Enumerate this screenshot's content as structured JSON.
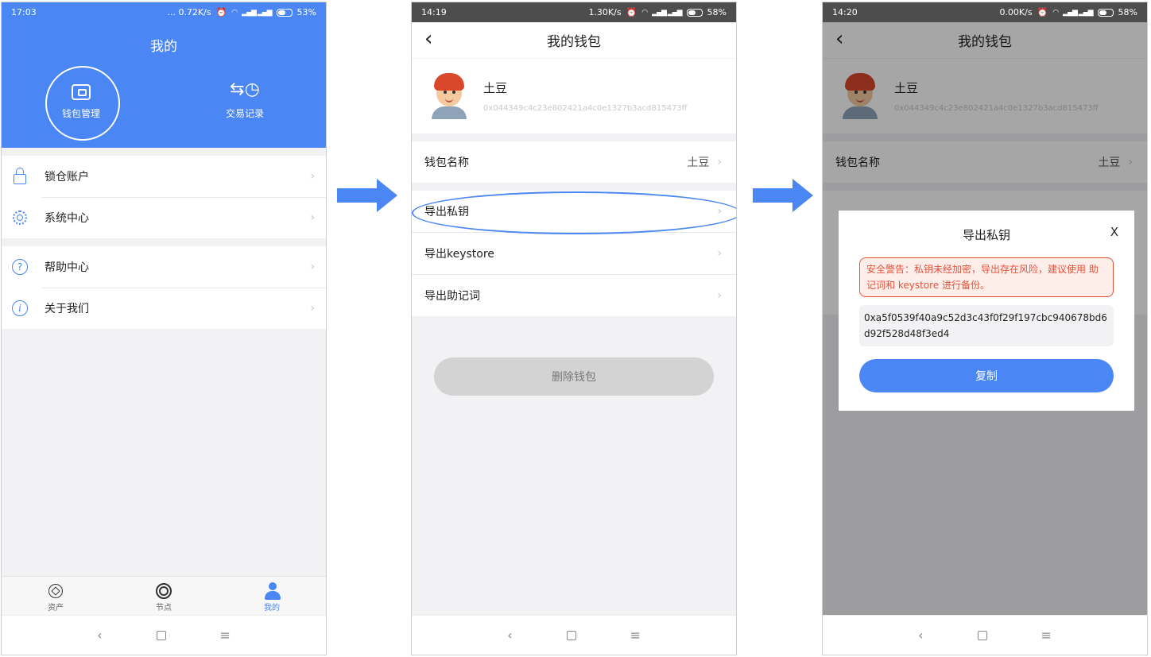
{
  "screen1": {
    "status": {
      "time": "17:03",
      "info": "... 0.72K/s",
      "battery": "53%"
    },
    "title": "我的",
    "hero_items": [
      {
        "label": "钱包管理"
      },
      {
        "label": "交易记录"
      }
    ],
    "menu_groups": [
      [
        {
          "label": "锁仓账户"
        },
        {
          "label": "系统中心"
        }
      ],
      [
        {
          "label": "帮助中心"
        },
        {
          "label": "关于我们"
        }
      ]
    ],
    "tabs": [
      {
        "label": "资产"
      },
      {
        "label": "节点"
      },
      {
        "label": "我的"
      }
    ]
  },
  "screen2": {
    "status": {
      "time": "14:19",
      "info": "1.30K/s",
      "battery": "58%"
    },
    "title": "我的钱包",
    "wallet_name": "土豆",
    "wallet_address": "0x044349c4c23e802421a4c0e1327b3acd815473ff",
    "rows": {
      "name_label": "钱包名称",
      "name_value": "土豆",
      "export_key": "导出私钥",
      "export_keystore": "导出keystore",
      "export_mnemonic": "导出助记词"
    },
    "delete_label": "删除钱包"
  },
  "screen3": {
    "status": {
      "time": "14:20",
      "info": "0.00K/s",
      "battery": "58%"
    },
    "title": "我的钱包",
    "wallet_name": "土豆",
    "wallet_address": "0x044349c4c23e802421a4c0e1327b3acd815473ff",
    "name_label": "钱包名称",
    "name_value": "土豆",
    "modal": {
      "title": "导出私钥",
      "close": "X",
      "warning": "安全警告：私钥未经加密，导出存在风险，建议使用 助记词和 keystore 进行备份。",
      "private_key": "0xa5f0539f40a9c52d3c43f0f29f197cbc940678bd6d92f528d48f3ed4",
      "copy_label": "复制"
    }
  },
  "colors": {
    "accent": "#4a86f4",
    "warning": "#e8503a"
  }
}
